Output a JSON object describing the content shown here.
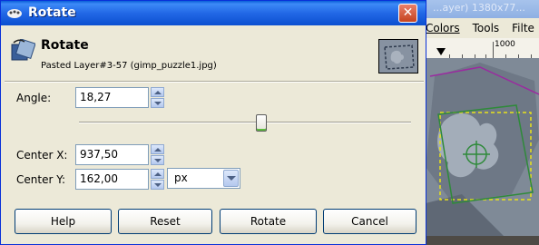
{
  "background_window": {
    "title_fragment": "...ayer) 1380x77...",
    "menus": [
      "Colors",
      "Tools",
      "Filte"
    ],
    "ruler_label": "1000"
  },
  "dialog": {
    "window_title": "Rotate",
    "close_label": "✕",
    "header_title": "Rotate",
    "header_subtitle": "Pasted Layer#3-57 (gimp_puzzle1.jpg)",
    "angle": {
      "label": "Angle:",
      "value": "18,27"
    },
    "angle_slider_fraction": 0.55,
    "center_x": {
      "label": "Center X:",
      "value": "937,50"
    },
    "center_y": {
      "label": "Center Y:",
      "value": "162,00"
    },
    "unit": {
      "selected": "px"
    },
    "buttons": {
      "help": "Help",
      "reset": "Reset",
      "rotate": "Rotate",
      "cancel": "Cancel"
    },
    "colors": {
      "titlebar": "#2268e6",
      "close_button": "#c5431f",
      "face": "#ece9d8",
      "slider_accent": "#5dbb3e"
    },
    "icons": [
      "window-icon",
      "close-icon",
      "rotate-tool-icon",
      "layer-preview-thumbnail",
      "spin-up-icon",
      "spin-down-icon",
      "dropdown-arrow-icon"
    ]
  }
}
